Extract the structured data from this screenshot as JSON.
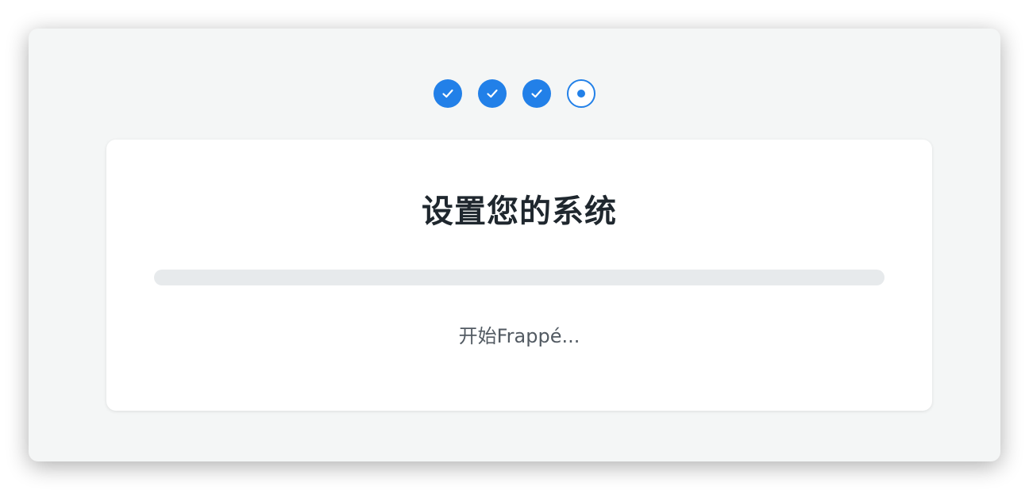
{
  "colors": {
    "accent": "#2280e8",
    "window_bg": "#f4f6f6",
    "card_bg": "#ffffff",
    "title_text": "#1f272e",
    "status_text": "#525a62",
    "track": "#e7eaec"
  },
  "steps": [
    {
      "state": "completed",
      "icon": "check-icon"
    },
    {
      "state": "completed",
      "icon": "check-icon"
    },
    {
      "state": "completed",
      "icon": "check-icon"
    },
    {
      "state": "current",
      "icon": "current-step-dot-icon"
    }
  ],
  "setup": {
    "title": "设置您的系统",
    "progress": 0,
    "status": "开始Frappé..."
  }
}
